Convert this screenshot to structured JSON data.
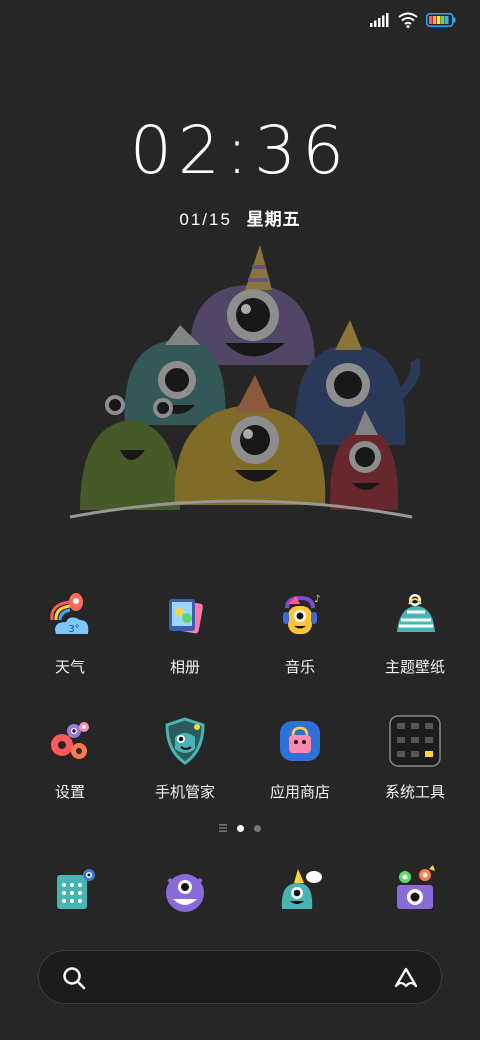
{
  "status_bar": {
    "signal_icon": "signal-bars-icon",
    "wifi_icon": "wifi-icon",
    "battery_icon": "battery-rainbow-icon"
  },
  "clock": {
    "time": "02:36"
  },
  "date": {
    "date": "01/15",
    "weekday": "星期五"
  },
  "apps": [
    {
      "label": "天气",
      "icon": "weather-icon"
    },
    {
      "label": "相册",
      "icon": "gallery-icon"
    },
    {
      "label": "音乐",
      "icon": "music-icon"
    },
    {
      "label": "主题壁纸",
      "icon": "theme-wallpaper-icon"
    },
    {
      "label": "设置",
      "icon": "settings-icon"
    },
    {
      "label": "手机管家",
      "icon": "phone-manager-icon"
    },
    {
      "label": "应用商店",
      "icon": "app-store-icon"
    },
    {
      "label": "系统工具",
      "icon": "system-tools-folder-icon"
    }
  ],
  "weather_badge": "3°",
  "page_indicator": {
    "pages": 2,
    "active": 0
  },
  "dock": [
    {
      "icon": "dialer-icon"
    },
    {
      "icon": "messages-monster-icon"
    },
    {
      "icon": "browser-monster-icon"
    },
    {
      "icon": "camera-monster-icon"
    }
  ],
  "search": {
    "search_icon": "search-icon",
    "assistant_icon": "assistant-icon"
  }
}
